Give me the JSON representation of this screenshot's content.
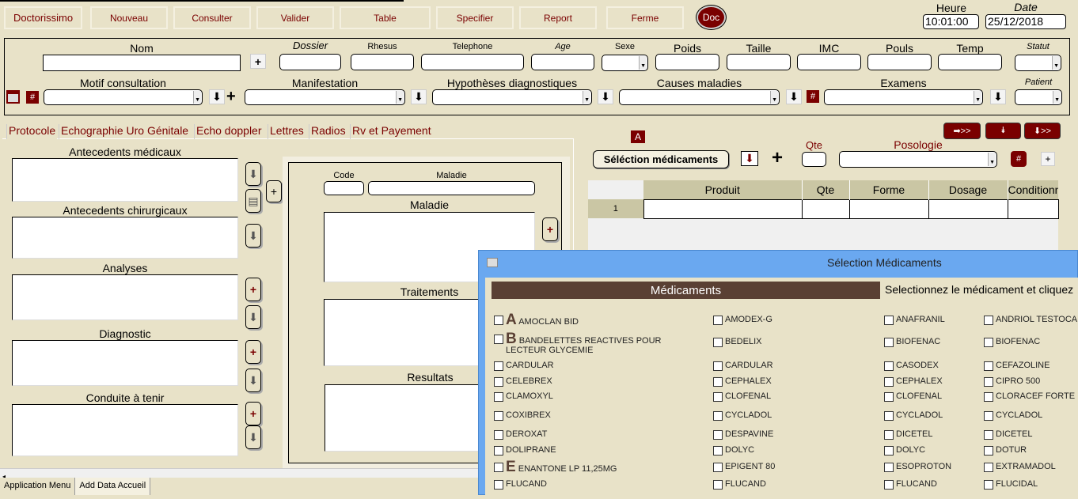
{
  "toolbar": {
    "buttons": [
      "Doctorissimo",
      "Nouveau",
      "Consulter",
      "Valider",
      "Table",
      "Specifier",
      "Report",
      "Ferme"
    ],
    "doc": "Doc"
  },
  "clock": {
    "heure_label": "Heure",
    "heure": "10:01:00",
    "date_label": "Date",
    "date": "25/12/2018"
  },
  "patient": {
    "row1": [
      "Nom",
      "Dossier",
      "Rhesus",
      "Telephone",
      "Age",
      "Sexe",
      "Poids",
      "Taille",
      "IMC",
      "Pouls",
      "Temp",
      "Statut"
    ],
    "row2": [
      "Motif consultation",
      "Manifestation",
      "Hypothèses diagnostiques",
      "Causes maladies",
      "Examens",
      "Patient"
    ],
    "plus": "+",
    "hash": "#"
  },
  "tabs": [
    "Protocole",
    "Echographie Uro Génitale",
    "Echo doppler",
    "Lettres",
    "Radios",
    "Rv et Payement"
  ],
  "protocole": {
    "sections": [
      "Antecedents médicaux",
      "Antecedents chirurgicaux",
      "Analyses",
      "Diagnostic",
      "Conduite à tenir"
    ],
    "code": "Code",
    "maladie": "Maladie",
    "maladie2": "Maladie",
    "traitements": "Traitements",
    "resultats": "Resultats"
  },
  "ordonnance": {
    "badge": "A",
    "select_button": "Séléction médicaments",
    "qte": "Qte",
    "posologie": "Posologie",
    "columns": [
      "Produit",
      "Qte",
      "Forme",
      "Dosage",
      "Conditionn"
    ],
    "row_num": "1"
  },
  "bottom_tabs": [
    "Application Menu",
    "Add Data Accueil"
  ],
  "dialog": {
    "title": "Sélection Médicaments",
    "header": "Médicaments",
    "instruction": "Selectionnez le médicament et cliquez",
    "rows": [
      {
        "letter": "A",
        "items": [
          "AMOCLAN BID",
          "AMODEX-G",
          "ANAFRANIL",
          "ANDRIOL TESTOCAPS"
        ]
      },
      {
        "letter": "B",
        "items": [
          "BANDELETTES REACTIVES POUR LECTEUR GLYCEMIE",
          "BEDELIX",
          "BIOFENAC",
          "BIOFENAC"
        ]
      },
      {
        "letter": "",
        "items": [
          "CARDULAR",
          "CARDULAR",
          "CASODEX",
          "CEFAZOLINE"
        ]
      },
      {
        "letter": "",
        "items": [
          "CELEBREX",
          "CEPHALEX",
          "CEPHALEX",
          "CIPRO 500"
        ]
      },
      {
        "letter": "",
        "items": [
          "CLAMOXYL",
          "CLOFENAL",
          "CLOFENAL",
          "CLORACEF FORTE"
        ]
      },
      {
        "letter": "",
        "items": [
          "COXIBREX",
          "CYCLADOL",
          "CYCLADOL",
          "CYCLADOL"
        ]
      },
      {
        "letter": "",
        "items": [
          "DEROXAT",
          "DESPAVINE",
          "DICETEL",
          "DICETEL"
        ]
      },
      {
        "letter": "",
        "items": [
          "DOLIPRANE",
          "DOLYC",
          "DOLYC",
          "DOTUR"
        ]
      },
      {
        "letter": "E",
        "items": [
          "ENANTONE LP 11,25MG",
          "EPIGENT 80",
          "ESOPROTON",
          "EXTRAMADOL"
        ]
      },
      {
        "letter": "",
        "items": [
          "FLUCAND",
          "FLUCAND",
          "FLUCAND",
          "FLUCIDAL"
        ]
      }
    ]
  },
  "colors": {
    "accent": "#7a0000",
    "dialog_title": "#6aa8f0",
    "header_brown": "#5a4034",
    "background": "#e8e2c8"
  }
}
